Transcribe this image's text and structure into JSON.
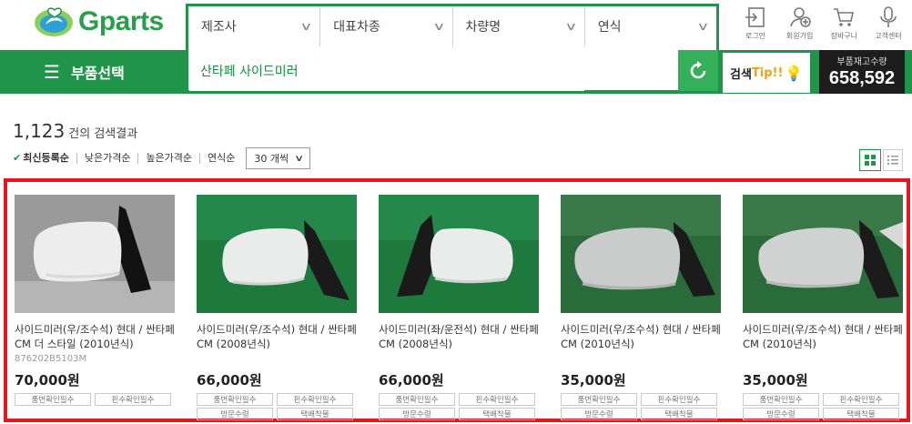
{
  "header": {
    "logo_text": "Gparts",
    "selects": [
      "제조사",
      "대표차종",
      "차량명",
      "연식"
    ],
    "menu_label": "부품선택",
    "query": "산타페 사이드미러",
    "top_icons": [
      {
        "label": "로그인",
        "icon": "login-icon"
      },
      {
        "label": "회원가입",
        "icon": "signup-icon"
      },
      {
        "label": "장바구니",
        "icon": "cart-icon"
      },
      {
        "label": "고객센터",
        "icon": "support-icon"
      }
    ],
    "tip_label_a": "검색",
    "tip_label_b": "Tip!!",
    "stock_label": "부품재고수량",
    "stock_value": "658,592",
    "brand_color": "#20954a"
  },
  "results": {
    "count": "1,123",
    "count_suffix": "건의 검색결과",
    "sort_options": [
      "최신등록순",
      "낮은가격순",
      "높은가격순",
      "연식순"
    ],
    "active_sort": "최신등록순",
    "per_page": "30 개씩"
  },
  "products": [
    {
      "name": "사이드미러(우/조수석) 현대 / 싼타페 CM 더 스타일 (2010년식)",
      "code": "876202B5103M",
      "price": "70,000원",
      "tags": [
        "품번확인필수",
        "핀수확인필수"
      ]
    },
    {
      "name": "사이드미러(우/조수석) 현대 / 싼타페 CM (2008년식)",
      "code": "",
      "price": "66,000원",
      "tags": [
        "품번확인필수",
        "핀수확인필수",
        "방문수령",
        "택배착불"
      ]
    },
    {
      "name": "사이드미러(좌/운전석) 현대 / 싼타페 CM (2008년식)",
      "code": "",
      "price": "66,000원",
      "tags": [
        "품번확인필수",
        "핀수확인필수",
        "방문수령",
        "택배착불"
      ]
    },
    {
      "name": "사이드미러(우/조수석) 현대 / 싼타페 CM (2010년식)",
      "code": "",
      "price": "35,000원",
      "tags": [
        "품번확인필수",
        "핀수확인필수",
        "방문수령",
        "택배착불"
      ]
    },
    {
      "name": "사이드미러(우/조수석) 현대 / 싼타페 CM (2010년식)",
      "code": "",
      "price": "35,000원",
      "tags": [
        "품번확인필수",
        "핀수확인필수",
        "방문수령",
        "택배착불"
      ]
    }
  ]
}
